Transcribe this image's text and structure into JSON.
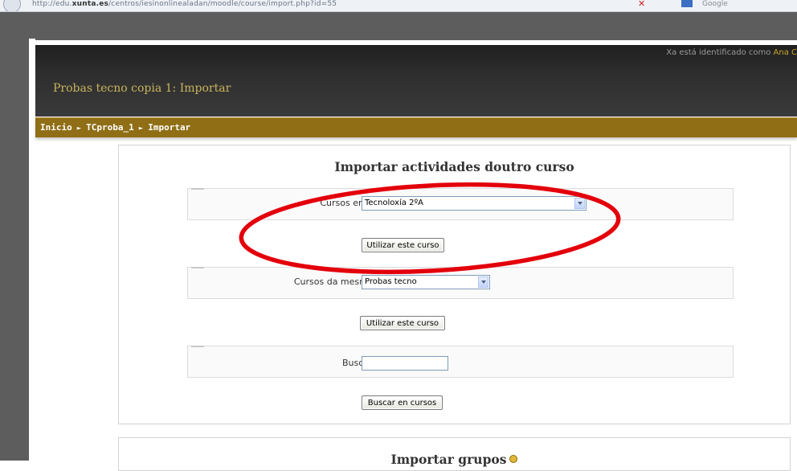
{
  "browser": {
    "url_prefix": "http://edu.",
    "url_domain": "xunta.es",
    "url_path": "/centros/iesinonlinealadan/moodle/course/import.php?id=55",
    "search_engine": "Google"
  },
  "header": {
    "logged_in_prefix": "Xa está identificado como",
    "user_name": "Ana C",
    "site_title": "Probas tecno copia 1: Importar"
  },
  "breadcrumb": {
    "items": [
      "Inicio",
      "TCproba_1",
      "Importar"
    ],
    "separator": "►"
  },
  "import_activities": {
    "title": "Importar actividades doutro curso",
    "taught_courses": {
      "label": "Cursos en que ensinei",
      "selected": "Tecnoloxía 2ºA",
      "button": "Utilizar este curso"
    },
    "same_category": {
      "label": "Cursos da mesma categoría",
      "selected": "Probas tecno",
      "button": "Utilizar este curso"
    },
    "search": {
      "label": "Buscar en cursos",
      "value": "",
      "button": "Buscar en cursos"
    }
  },
  "import_groups": {
    "title": "Importar grupos"
  },
  "colors": {
    "nav_bar": "#8f6e16",
    "title_text": "#c9b45c",
    "annotation": "#e3000b"
  }
}
